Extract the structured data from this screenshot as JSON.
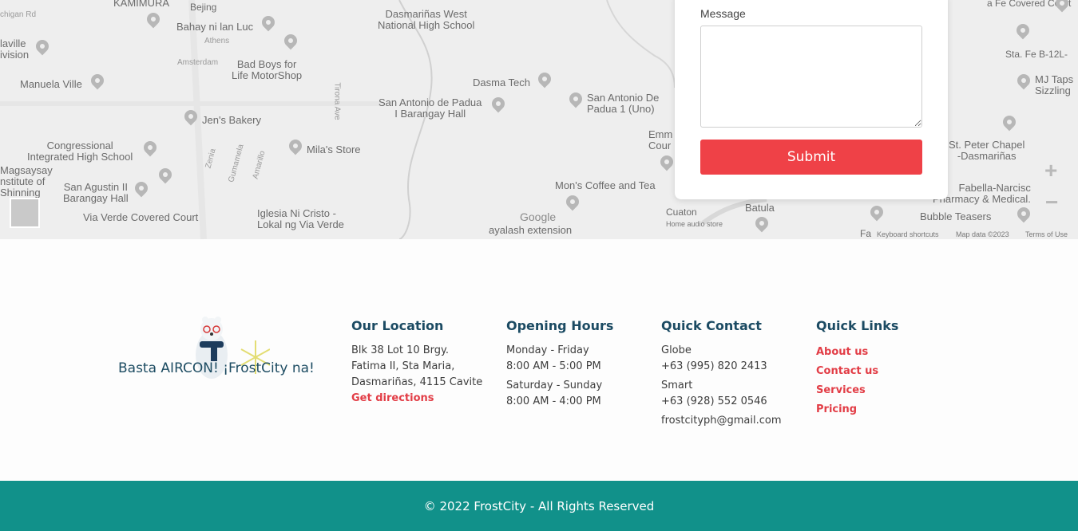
{
  "map": {
    "labels": {
      "kamimura": "KAMIMURA",
      "bejing": "Bejing",
      "chigan_rd": "chigan Rd",
      "dasma_west": "Dasmariñas West\nNational High School",
      "laville": "laville\nivision",
      "bahay": "Bahay ni lan Luc",
      "athens": "Athens",
      "amsterdam": "Amsterdam",
      "bad_boys": "Bad Boys for\nLife MotorShop",
      "manuela": "Manuela Ville",
      "tirona": "Tirona Ave",
      "dasma_tech": "Dasma Tech",
      "san_antonio_hall": "San Antonio de Padua\nI Barangay Hall",
      "san_antonio_uno": "San Antonio De\nPadua 1 (Uno)",
      "jens": "Jen's Bakery",
      "congressional": "Congressional\nIntegrated High School",
      "milas": "Mila's Store",
      "zenia": "Zenia",
      "gumamela": "Gumamela",
      "amarillo": "Amarillo",
      "emmc": "Emm\nCour",
      "magsaysay": "Magsaysay\nnstitute of\nShinning",
      "san_agustin": "San Agustin II\nBarangay Hall",
      "mons": "Mon's Coffee and Tea",
      "via_verde": "Via Verde Covered Court",
      "iglesia": "Iglesia Ni Cristo -\nLokal ng Via Verde",
      "google": "Google",
      "ayalash": "ayalash extension",
      "cuaton": "Cuaton",
      "home_audio": "Home audio store",
      "batula": "Batula",
      "sta_fe_covered": "a Fe Covered Court",
      "sta_fe_b12": "Sta. Fe B-12L-",
      "mj_taps": "MJ Taps\nSizzling",
      "st_peter": "St. Peter Chapel\n-Dasmariñas",
      "fabella": "Fabella-Narcisc\nPharmacy & Medical.",
      "bubble": "Bubble Teasers",
      "fa": "Fa",
      "keyboard": "Keyboard shortcuts",
      "mapdata": "Map data ©2023",
      "terms": "Terms of Use"
    },
    "zoom_in": "+",
    "zoom_out": "−"
  },
  "form": {
    "message_label": "Message",
    "message_value": "",
    "submit_label": "Submit"
  },
  "footer": {
    "logo_text": "Basta AIRCON! ¡FrostCity na!",
    "location": {
      "title": "Our Location",
      "line1": "Blk 38 Lot 10 Brgy.",
      "line2": "Fatima II, Sta Maria,",
      "line3": "Dasmariñas, 4115 Cavite",
      "directions": "Get directions"
    },
    "hours": {
      "title": "Opening Hours",
      "days1": "Monday - Friday",
      "time1": "8:00 AM - 5:00 PM",
      "days2": "Saturday - Sunday",
      "time2": "8:00 AM - 4:00 PM"
    },
    "contact": {
      "title": "Quick Contact",
      "carrier1": "Globe",
      "phone1": "+63 (995) 820 2413",
      "carrier2": "Smart",
      "phone2": "+63 (928) 552 0546",
      "email": "frostcityph@gmail.com"
    },
    "links": {
      "title": "Quick Links",
      "items": [
        "About us",
        "Contact us",
        "Services",
        "Pricing"
      ]
    },
    "copyright": "© 2022 FrostCity - All Rights Reserved"
  },
  "colors": {
    "accent_red": "#ef4147",
    "heading_blue": "#1c4b63",
    "footer_teal": "#11918a"
  }
}
